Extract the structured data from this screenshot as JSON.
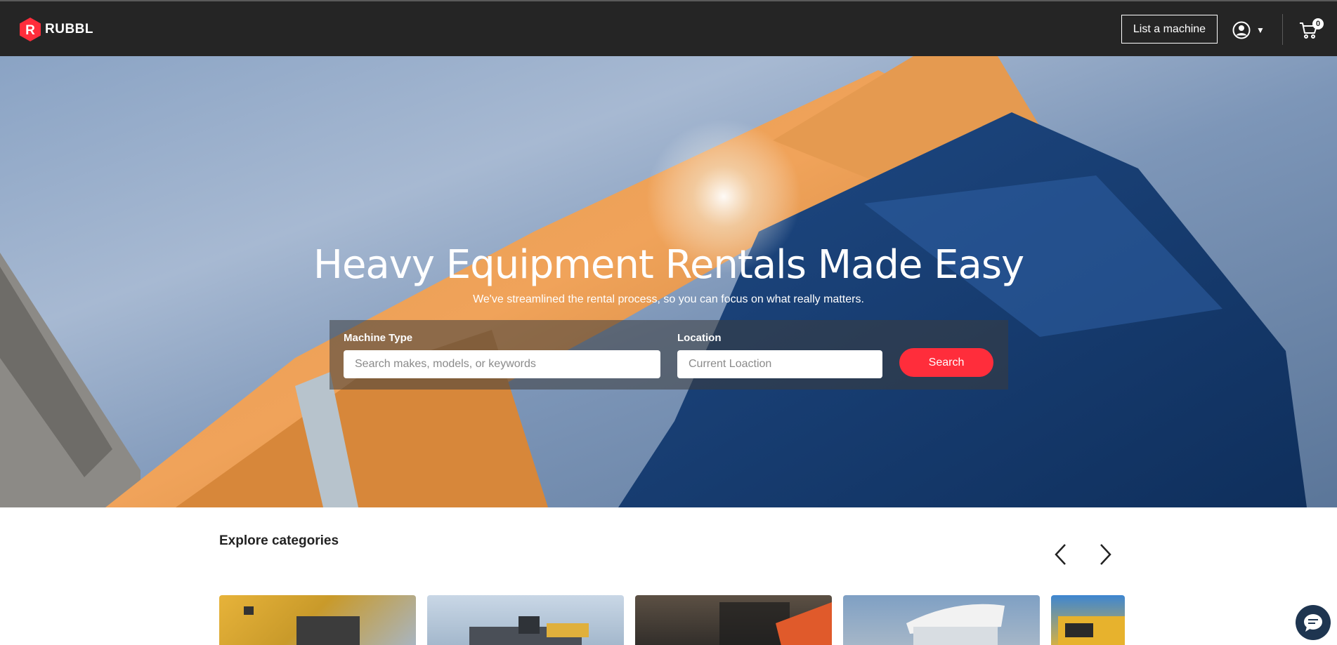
{
  "brand": {
    "name": "RUBBL",
    "mark": "R",
    "accent": "#ff2d3b"
  },
  "nav": {
    "list_machine_label": "List a machine",
    "cart_count": "0"
  },
  "hero": {
    "title": "Heavy Equipment Rentals Made Easy",
    "subtitle": "We've streamlined the rental process, so you can focus on what really matters."
  },
  "search": {
    "machine_type_label": "Machine Type",
    "machine_type_placeholder": "Search makes, models, or keywords",
    "location_label": "Location",
    "location_placeholder": "Current Loaction",
    "search_button": "Search"
  },
  "categories": {
    "title": "Explore categories",
    "prev_icon": "chevron-left-icon",
    "next_icon": "chevron-right-icon"
  },
  "icons": {
    "user": "user-circle-icon",
    "cart": "cart-icon",
    "chat": "chat-icon"
  }
}
